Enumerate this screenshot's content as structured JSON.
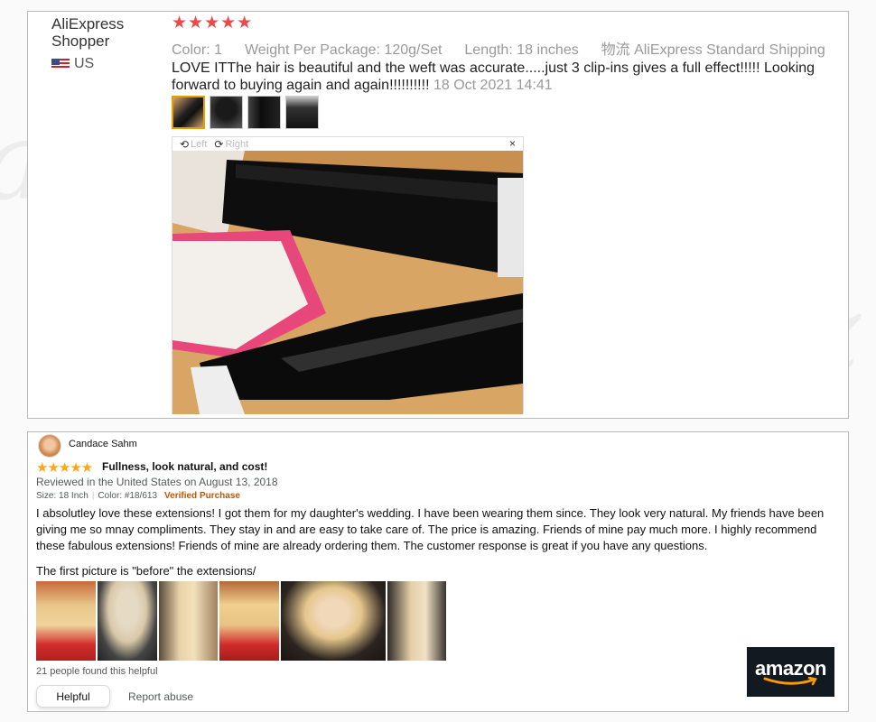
{
  "aliexpress": {
    "user_name": "AliExpress Shopper",
    "country": "US",
    "rating_stars": "★★★★★",
    "rating": 5,
    "meta": {
      "color_label": "Color:",
      "color_value": "1",
      "weight_label": "Weight Per Package:",
      "weight_value": "120g/Set",
      "length_label": "Length:",
      "length_value": "18 inches",
      "shipping_label": "物流",
      "shipping_value": "AliExpress Standard Shipping"
    },
    "review_text": "LOVE ITThe hair is beautiful and the weft was accurate.....just 3 clip-ins gives a full effect!!!!! Looking forward to buying again and again!!!!!!!!!!",
    "review_date": "18 Oct 2021 14:41",
    "viewer": {
      "rotate_left": "Left",
      "rotate_right": "Right",
      "close": "×"
    },
    "colors": {
      "star": "#f0484a",
      "meta_text": "#999999"
    }
  },
  "amazon": {
    "reviewer_name": "Candace Sahm",
    "rating_stars": "★★★★★",
    "rating": 5,
    "title": "Fullness, look natural, and cost!",
    "reviewed_in": "Reviewed in the United States on August 13, 2018",
    "size": "Size: 18 Inch",
    "color": "Color: #18/613",
    "verified": "Verified Purchase",
    "body": "I absolutley love these extensions! I got them for my daughter's wedding. I have been wearing them since. They look very natural. My friends have been giving me so mnay compliments. They stay in and are easy to take care of. The price is amazing. Friends of mine pay much more. I highly recommend these fabulous extensions! Friends of mine are already ordering them. The customer response is great if you have any questions.",
    "caption": "The first picture is \"before\" the extensions/",
    "helpful_count": "21 people found this helpful",
    "helpful_button": "Helpful",
    "report_abuse": "Report abuse",
    "logo_text": "amazon",
    "colors": {
      "star": "#ffa41c",
      "verified": "#c45500",
      "logo_bg": "#131921",
      "smile": "#ff9900"
    }
  }
}
